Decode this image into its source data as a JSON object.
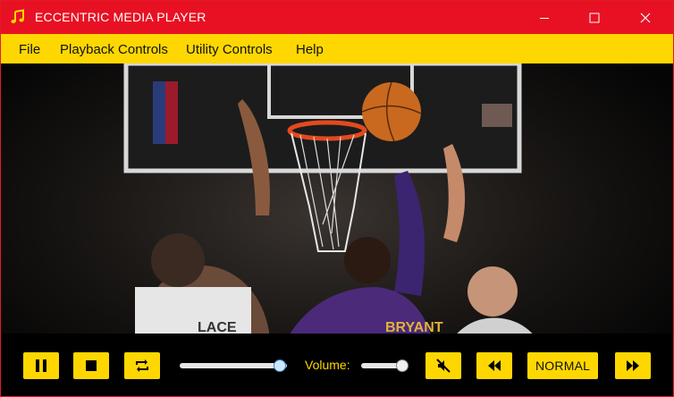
{
  "window": {
    "title": "ECCENTRIC MEDIA PLAYER"
  },
  "menu": [
    "File",
    "Playback Controls",
    "Utility Controls",
    "Help"
  ],
  "controls": {
    "volume_label": "Volume:",
    "speed_label": "NORMAL",
    "seek_progress": 0.93,
    "volume_level": 1.0,
    "buttons": [
      "pause-icon",
      "stop-icon",
      "repeat-icon",
      "mute-icon",
      "rewind-icon",
      "fast-forward-icon"
    ]
  },
  "colors": {
    "titlebar": "#e81123",
    "menubar": "#ffd700",
    "controls_bg": "#000000",
    "accent": "#ffd700"
  }
}
